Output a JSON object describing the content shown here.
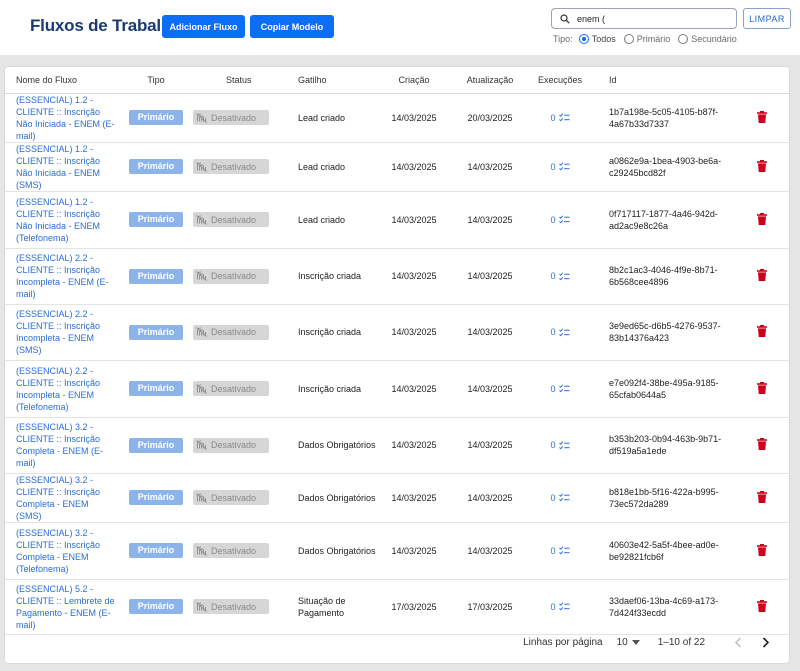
{
  "header": {
    "title": "Fluxos de Trabalho",
    "add_label": "Adicionar Fluxo",
    "copy_label": "Copiar Modelo",
    "search_value": "enem (",
    "clear_label": "LIMPAR",
    "filter_label": "Tipo:",
    "filter_options": [
      "Todos",
      "Primário",
      "Secundário"
    ],
    "filter_selected": "Todos"
  },
  "table": {
    "columns": [
      "Nome do Fluxo",
      "Tipo",
      "Status",
      "Gatilho",
      "Criação",
      "Atualização",
      "Execuções",
      "Id"
    ],
    "rows": [
      {
        "name": "(ESSENCIAL) 1.2 - CLIENTE :: Inscrição Não Iniciada - ENEM (E-mail)",
        "type": "Primário",
        "status": "Desativado",
        "trigger": "Lead criado",
        "created": "14/03/2025",
        "updated": "20/03/2025",
        "executions": "0",
        "id": "1b7a198e-5c05-4105-b87f-4a67b33d7337"
      },
      {
        "name": "(ESSENCIAL) 1.2 - CLIENTE :: Inscrição Não Iniciada - ENEM (SMS)",
        "type": "Primário",
        "status": "Desativado",
        "trigger": "Lead criado",
        "created": "14/03/2025",
        "updated": "14/03/2025",
        "executions": "0",
        "id": "a0862e9a-1bea-4903-be6a-c29245bcd82f"
      },
      {
        "name": "(ESSENCIAL) 1.2 - CLIENTE :: Inscrição Não Iniciada - ENEM (Telefonema)",
        "type": "Primário",
        "status": "Desativado",
        "trigger": "Lead criado",
        "created": "14/03/2025",
        "updated": "14/03/2025",
        "executions": "0",
        "id": "0f717117-1877-4a46-942d-ad2ac9e8c26a"
      },
      {
        "name": "(ESSENCIAL) 2.2 - CLIENTE :: Inscrição Incompleta - ENEM (E-mail)",
        "type": "Primário",
        "status": "Desativado",
        "trigger": "Inscrição criada",
        "created": "14/03/2025",
        "updated": "14/03/2025",
        "executions": "0",
        "id": "8b2c1ac3-4046-4f9e-8b71-6b568cee4896"
      },
      {
        "name": "(ESSENCIAL) 2.2 - CLIENTE :: Inscrição Incompleta - ENEM (SMS)",
        "type": "Primário",
        "status": "Desativado",
        "trigger": "Inscrição criada",
        "created": "14/03/2025",
        "updated": "14/03/2025",
        "executions": "0",
        "id": "3e9ed65c-d6b5-4276-9537-83b14376a423"
      },
      {
        "name": "(ESSENCIAL) 2.2 - CLIENTE :: Inscrição Incompleta - ENEM (Telefonema)",
        "type": "Primário",
        "status": "Desativado",
        "trigger": "Inscrição criada",
        "created": "14/03/2025",
        "updated": "14/03/2025",
        "executions": "0",
        "id": "e7e092f4-38be-495a-9185-65cfab0644a5"
      },
      {
        "name": "(ESSENCIAL) 3.2 - CLIENTE :: Inscrição Completa - ENEM (E-mail)",
        "type": "Primário",
        "status": "Desativado",
        "trigger": "Dados Obrigatórios",
        "created": "14/03/2025",
        "updated": "14/03/2025",
        "executions": "0",
        "id": "b353b203-0b94-463b-9b71-df519a5a1ede"
      },
      {
        "name": "(ESSENCIAL) 3.2 - CLIENTE :: Inscrição Completa - ENEM (SMS)",
        "type": "Primário",
        "status": "Desativado",
        "trigger": "Dados Obrigatórios",
        "created": "14/03/2025",
        "updated": "14/03/2025",
        "executions": "0",
        "id": "b818e1bb-5f16-422a-b995-73ec572da289"
      },
      {
        "name": "(ESSENCIAL) 3.2 - CLIENTE :: Inscrição Completa - ENEM (Telefonema)",
        "type": "Primário",
        "status": "Desativado",
        "trigger": "Dados Obrigatórios",
        "created": "14/03/2025",
        "updated": "14/03/2025",
        "executions": "0",
        "id": "40603e42-5a5f-4bee-ad0e-be92821fcb6f"
      },
      {
        "name": "(ESSENCIAL) 5.2 - CLIENTE :: Lembrete de Pagamento - ENEM (E-mail)",
        "type": "Primário",
        "status": "Desativado",
        "trigger": "Situação de Pagamento",
        "created": "17/03/2025",
        "updated": "17/03/2025",
        "executions": "0",
        "id": "33daef06-13ba-4c69-a173-7d424f33ecdd"
      }
    ]
  },
  "pagination": {
    "rows_per_page_label": "Linhas por página",
    "rows_per_page_value": "10",
    "range_text": "1–10 of 22"
  },
  "colors": {
    "accent": "#0b6ef5",
    "title": "#1a3a73",
    "link": "#2a6dd6",
    "type_badge": "#8db4ea",
    "status_badge": "#d6d6d6",
    "delete": "#d0021b"
  }
}
